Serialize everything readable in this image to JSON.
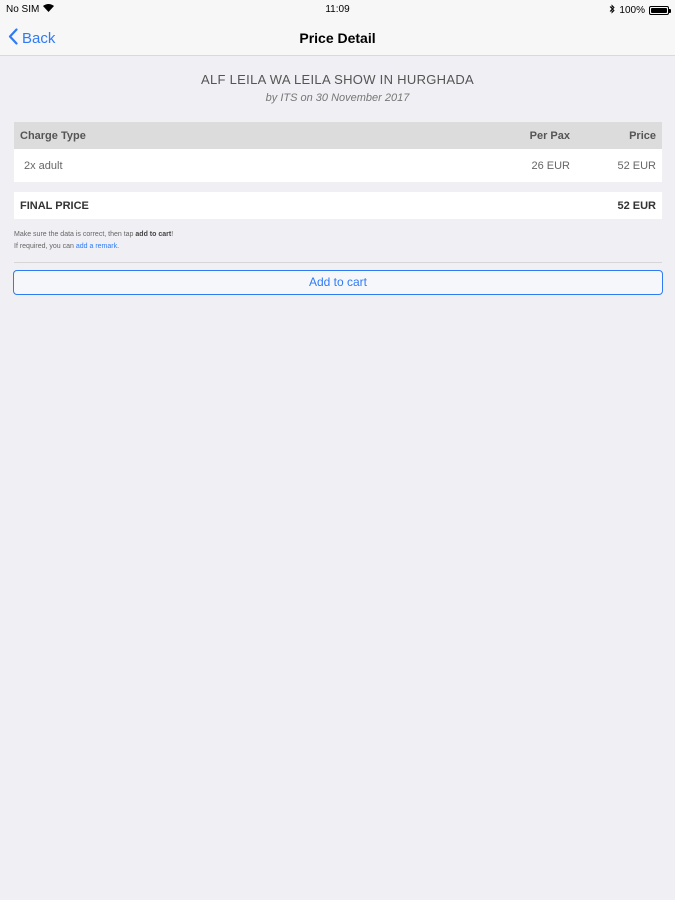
{
  "status_bar": {
    "carrier": "No SIM",
    "time": "11:09",
    "battery": "100%",
    "battery_level": 1.0
  },
  "nav": {
    "back_label": "Back",
    "title": "Price Detail"
  },
  "event": {
    "title": "ALF LEILA WA LEILA SHOW IN HURGHADA",
    "subtitle": "by ITS on 30 November 2017"
  },
  "table": {
    "headers": [
      "Charge Type",
      "Per Pax",
      "Price"
    ],
    "rows": [
      {
        "type": "2x adult",
        "per_pax": "26 EUR",
        "price": "52 EUR"
      }
    ]
  },
  "final": {
    "label": "FINAL PRICE",
    "value": "52 EUR"
  },
  "notes": {
    "line1_prefix": "Make sure the data is correct, then tap ",
    "line1_bold": "add to cart",
    "line1_suffix": "!",
    "line2_prefix": "If required, you can ",
    "line2_link": "add a remark",
    "line2_suffix": "."
  },
  "actions": {
    "add_to_cart": "Add to cart"
  },
  "colors": {
    "accent": "#2f7bf5",
    "background": "#efeff4"
  }
}
